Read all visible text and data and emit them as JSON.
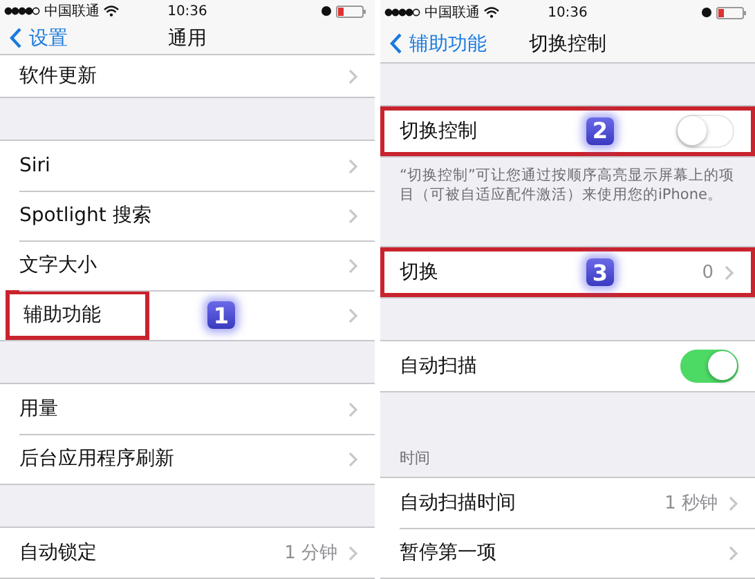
{
  "panels": [
    {
      "status_bar": {
        "carrier": "中国联通",
        "time": "10:36"
      },
      "nav": {
        "back": "设置",
        "title": "通用"
      },
      "sections": [
        {
          "cut_top": true,
          "rows": [
            {
              "kind": "chevron",
              "label": "软件更新"
            }
          ]
        },
        {
          "rows": [
            {
              "kind": "chevron",
              "label": "Siri"
            },
            {
              "kind": "chevron",
              "label": "Spotlight 搜索"
            },
            {
              "kind": "chevron",
              "label": "文字大小"
            },
            {
              "kind": "chevron",
              "label": "辅助功能",
              "annotation": {
                "number": "1",
                "whole_row": false
              }
            }
          ]
        },
        {
          "rows": [
            {
              "kind": "chevron",
              "label": "用量"
            },
            {
              "kind": "chevron",
              "label": "后台应用程序刷新"
            }
          ]
        },
        {
          "rows": [
            {
              "kind": "chevron",
              "label": "自动锁定",
              "value": "1 分钟"
            }
          ]
        }
      ]
    },
    {
      "status_bar": {
        "carrier": "中国联通",
        "time": "10:36"
      },
      "nav": {
        "back": "辅助功能",
        "title": "切换控制"
      },
      "sections": [
        {
          "rows": [
            {
              "kind": "toggle",
              "label": "切换控制",
              "on": false,
              "annotation": {
                "number": "2",
                "whole_row": true
              }
            }
          ],
          "footer": "“切换控制”可让您通过按顺序高亮显示屏幕上的项目（可被自适应配件激活）来使用您的iPhone。"
        },
        {
          "rows": [
            {
              "kind": "chevron",
              "label": "切换",
              "value": "0",
              "annotation": {
                "number": "3",
                "whole_row": true
              }
            }
          ]
        },
        {
          "rows": [
            {
              "kind": "toggle",
              "label": "自动扫描",
              "on": true
            }
          ]
        },
        {
          "header": "时间",
          "rows": [
            {
              "kind": "chevron",
              "label": "自动扫描时间",
              "value": "1 秒钟"
            },
            {
              "kind": "chevron",
              "label": "暂停第一项"
            }
          ]
        }
      ]
    }
  ]
}
